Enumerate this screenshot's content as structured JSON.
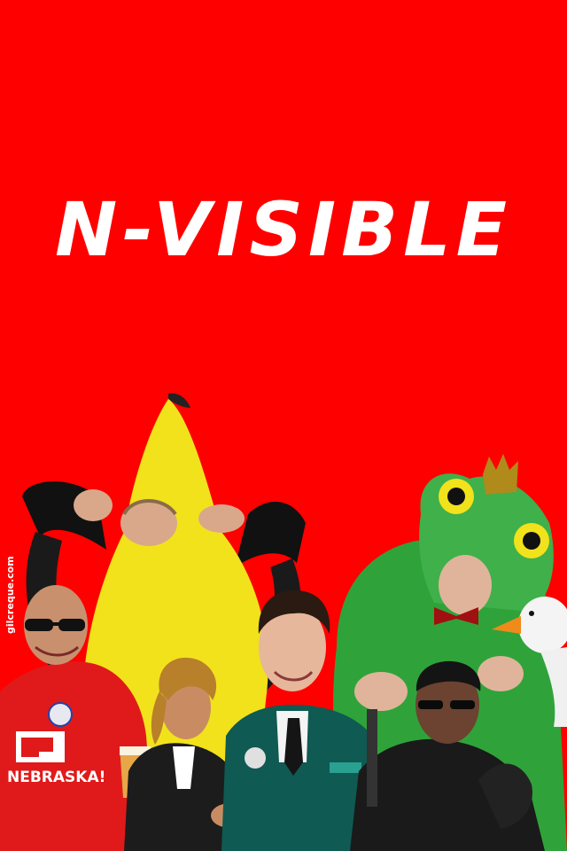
{
  "poster": {
    "title": "N-VISIBLE",
    "credit": "gilcreque.com",
    "shirt_text": "NEBRASKA!",
    "colors": {
      "background": "#ff0000",
      "title": "#ffffff",
      "banana": "#f2e21b",
      "frog": "#2fa33a",
      "jacket_green": "#0f5a52",
      "leather": "#1a1a1a",
      "red_shirt": "#e01a1a"
    },
    "figures": [
      {
        "name": "banana-costume-person"
      },
      {
        "name": "frog-costume-person"
      },
      {
        "name": "sunglasses-man-red-shirt"
      },
      {
        "name": "woman-in-blazer"
      },
      {
        "name": "young-man-green-jacket"
      },
      {
        "name": "man-leather-coat-sunglasses"
      },
      {
        "name": "goose"
      }
    ]
  }
}
